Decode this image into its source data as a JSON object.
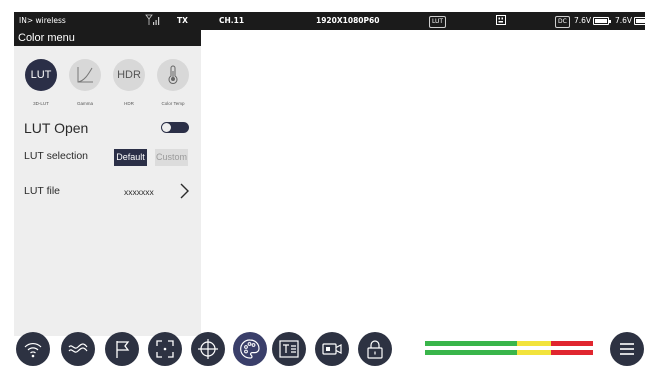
{
  "status_bar": {
    "input": "IN> wireless",
    "tx": "TX",
    "channel": "CH.11",
    "resolution": "1920X1080P60",
    "lut_badge": "LUT",
    "dc_badge": "DC",
    "battery_1": "7.6V",
    "battery_2": "7.6V"
  },
  "color_menu": {
    "title": "Color menu",
    "modes": [
      {
        "label": "3D-LUT",
        "icon": "LUT",
        "active": true
      },
      {
        "label": "Gamma",
        "icon": "gamma-curve-icon",
        "active": false
      },
      {
        "label": "HDR",
        "icon": "HDR",
        "active": false
      },
      {
        "label": "Color Temp",
        "icon": "thermometer-icon",
        "active": false
      }
    ],
    "lut_open": {
      "label": "LUT Open",
      "state": "on"
    },
    "lut_selection": {
      "label": "LUT selection",
      "options": [
        "Default",
        "Custom"
      ],
      "selected": "Default"
    },
    "lut_file": {
      "label": "LUT file",
      "value": "xxxxxxx"
    }
  },
  "toolbar": {
    "tools": [
      "wireless-icon",
      "waveform-icon",
      "flag-icon",
      "focus-frame-icon",
      "crosshair-icon",
      "color-palette-icon",
      "text-layout-icon",
      "video-camera-icon",
      "lock-icon"
    ],
    "active_tool": "color-palette-icon",
    "menu_icon": "hamburger-menu-icon"
  },
  "colors": {
    "bar": "#1b1b1b",
    "accent": "#2b2f47",
    "tool": "#2d3242",
    "meter_green": "#39b54a",
    "meter_yellow": "#f2e33c",
    "meter_red": "#e0262f"
  }
}
